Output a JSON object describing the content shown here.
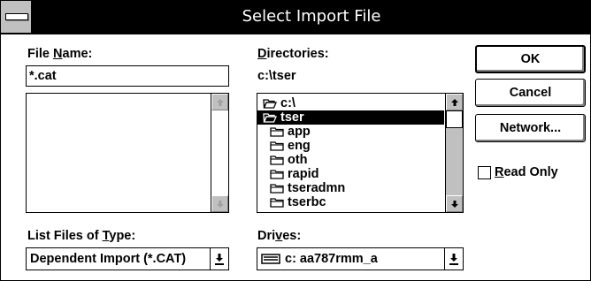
{
  "window": {
    "title": "Select Import File",
    "system_menu_icon": "minus-bar-icon"
  },
  "file_name": {
    "label_pre": "File ",
    "label_key": "N",
    "label_post": "ame:",
    "value": "*.cat",
    "files": []
  },
  "directories": {
    "label_key": "D",
    "label_post": "irectories:",
    "current_path": "c:\\tser",
    "tree": [
      {
        "name": "c:\\",
        "icon": "open-folder-icon",
        "indent": 0,
        "selected": false
      },
      {
        "name": "tser",
        "icon": "open-folder-icon",
        "indent": 1,
        "selected": true
      },
      {
        "name": "app",
        "icon": "folder-icon",
        "indent": 2,
        "selected": false
      },
      {
        "name": "eng",
        "icon": "folder-icon",
        "indent": 2,
        "selected": false
      },
      {
        "name": "oth",
        "icon": "folder-icon",
        "indent": 2,
        "selected": false
      },
      {
        "name": "rapid",
        "icon": "folder-icon",
        "indent": 2,
        "selected": false
      },
      {
        "name": "tseradmn",
        "icon": "folder-icon",
        "indent": 2,
        "selected": false
      },
      {
        "name": "tserbc",
        "icon": "folder-icon",
        "indent": 2,
        "selected": false
      }
    ]
  },
  "file_type": {
    "label_pre": "List Files of ",
    "label_key": "T",
    "label_post": "ype:",
    "value": "Dependent Import (*.CAT)"
  },
  "drives": {
    "label_pre": "Dri",
    "label_key": "v",
    "label_post": "es:",
    "value": "c: aa787rmm_a",
    "icon": "drive-icon"
  },
  "buttons": {
    "ok": "OK",
    "cancel": "Cancel",
    "network": "Network..."
  },
  "read_only": {
    "label_key": "R",
    "label_post": "ead Only",
    "checked": false
  }
}
